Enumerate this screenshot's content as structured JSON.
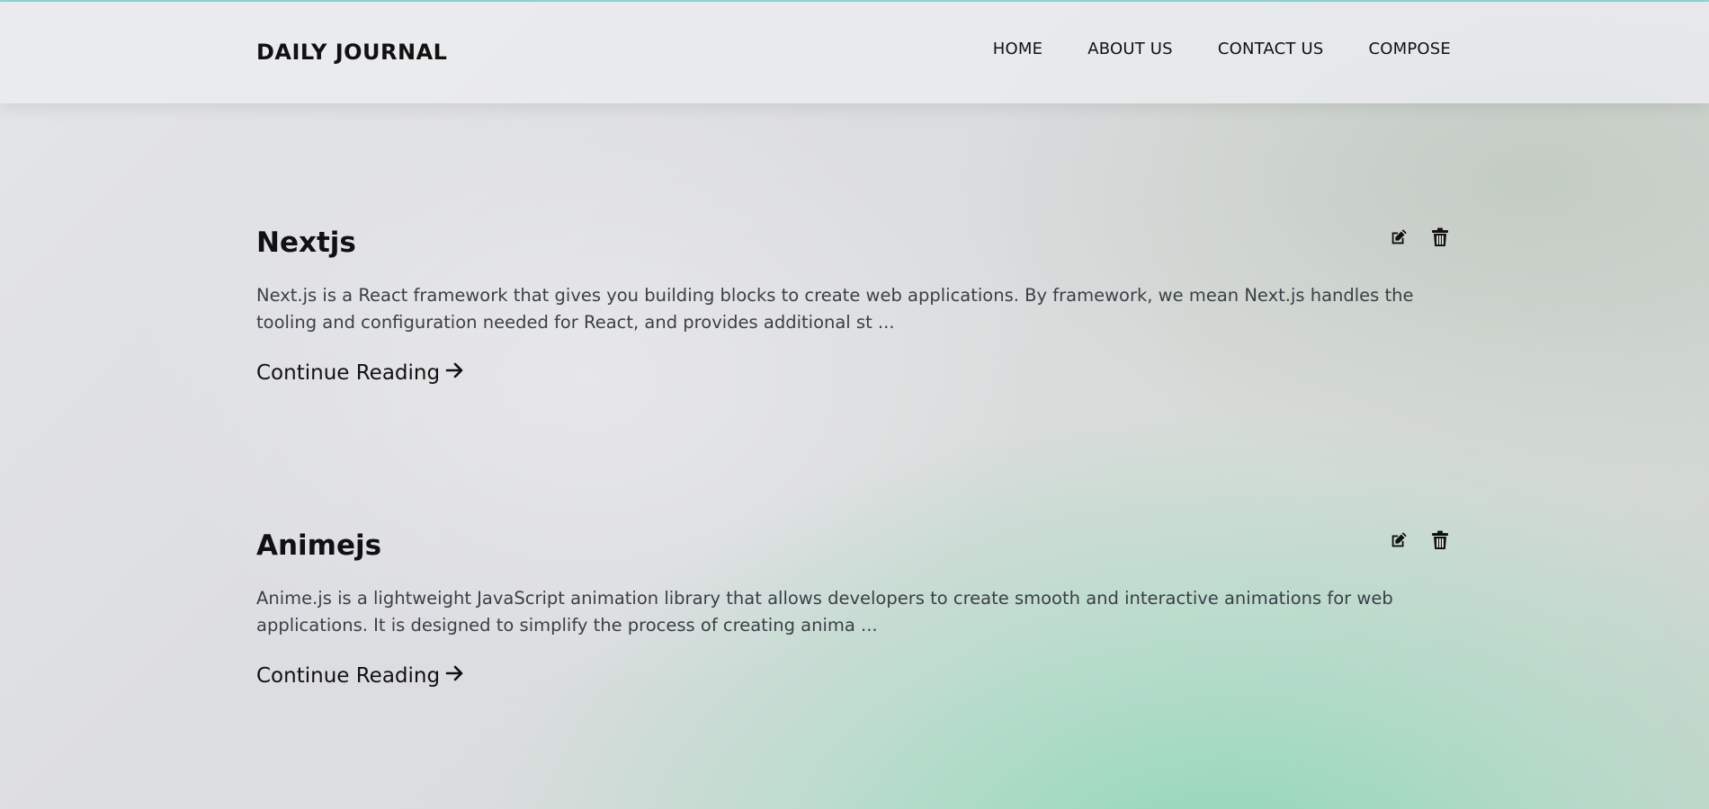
{
  "header": {
    "brand": "DAILY JOURNAL",
    "nav": [
      "HOME",
      "ABOUT US",
      "CONTACT US",
      "COMPOSE"
    ]
  },
  "posts": [
    {
      "title": "Nextjs",
      "excerpt": "Next.js is a React framework that gives you building blocks to create web applications. By framework, we mean Next.js handles the tooling and configuration needed for React, and provides additional st ...",
      "read_more": "Continue Reading",
      "edit_icon": "edit-icon",
      "delete_icon": "trash-icon"
    },
    {
      "title": "Animejs",
      "excerpt": "Anime.js is a lightweight JavaScript animation library that allows developers to create smooth and interactive animations for web applications. It is designed to simplify the process of creating anima ...",
      "read_more": "Continue Reading",
      "edit_icon": "edit-icon",
      "delete_icon": "trash-icon"
    }
  ]
}
